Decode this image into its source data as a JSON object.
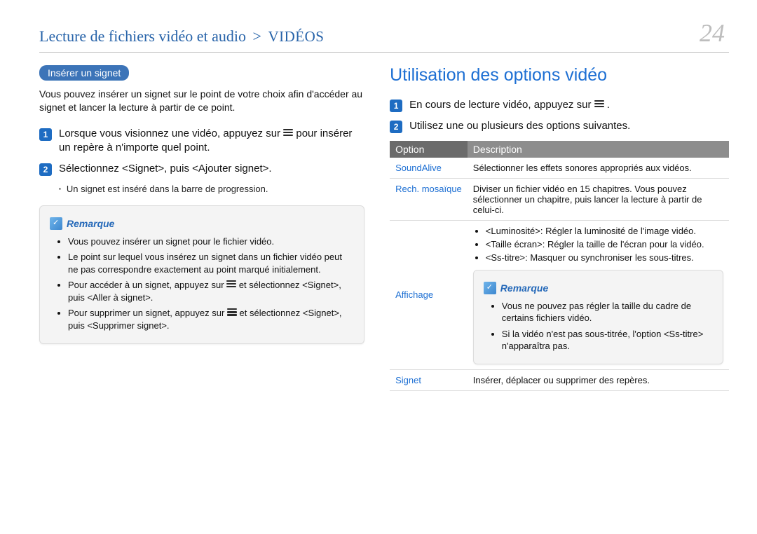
{
  "header": {
    "breadcrumb_main": "Lecture de fichiers vidéo et audio",
    "breadcrumb_sep": ">",
    "breadcrumb_sub": "VIDÉOS",
    "page_number": "24"
  },
  "left": {
    "pill": "Insérer un signet",
    "intro": "Vous pouvez insérer un signet sur le point de votre choix afin d'accéder au signet et lancer la lecture à partir de ce point.",
    "step1_before": "Lorsque vous visionnez une vidéo, appuyez sur ",
    "step1_after": " pour insérer un repère à n'importe quel point.",
    "step2": "Sélectionnez <Signet>, puis <Ajouter signet>.",
    "step2_sub": "Un signet est inséré dans la barre de progression.",
    "note_label": "Remarque",
    "note_items": {
      "a": "Vous pouvez insérer un signet pour le fichier vidéo.",
      "b": "Le point sur lequel vous insérez un signet dans un fichier vidéo peut ne pas correspondre exactement au point marqué initialement.",
      "c_before": "Pour accéder à un signet, appuyez sur ",
      "c_after": " et sélectionnez <Signet>, puis <Aller à signet>.",
      "d_before": "Pour supprimer un signet, appuyez sur ",
      "d_after": " et sélectionnez <Signet>, puis <Supprimer signet>."
    }
  },
  "right": {
    "heading": "Utilisation des options vidéo",
    "step1_before": "En cours de lecture vidéo, appuyez sur ",
    "step1_after": ".",
    "step2": "Utilisez une ou plusieurs des options suivantes.",
    "th_option": "Option",
    "th_desc": "Description",
    "rows": {
      "soundalive": {
        "name": "SoundAlive",
        "desc": "Sélectionner les effets sonores appropriés aux vidéos."
      },
      "rech": {
        "name": "Rech. mosaïque",
        "desc": "Diviser un fichier vidéo en 15 chapitres. Vous pouvez sélectionner un chapitre, puis lancer la lecture à partir de celui-ci."
      },
      "affichage": {
        "name": "Affichage",
        "bullets": {
          "a": "<Luminosité>: Régler la luminosité de l'image vidéo.",
          "b": "<Taille écran>: Régler la taille de l'écran pour la vidéo.",
          "c": "<Ss-titre>: Masquer ou synchroniser les sous-titres."
        },
        "note_label": "Remarque",
        "note_items": {
          "a": "Vous ne pouvez pas régler la taille du cadre de certains fichiers vidéo.",
          "b": "Si la vidéo n'est pas sous-titrée, l'option <Ss-titre> n'apparaîtra pas."
        }
      },
      "signet": {
        "name": "Signet",
        "desc": "Insérer, déplacer ou supprimer des repères."
      }
    }
  }
}
